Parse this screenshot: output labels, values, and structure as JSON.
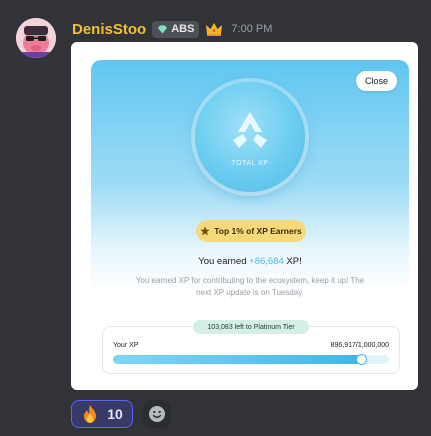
{
  "message": {
    "username": "DenisStoo",
    "role_tag": "ABS",
    "timestamp": "7:00 PM"
  },
  "embed": {
    "close_label": "Close",
    "coin_label": "TOTAL XP",
    "badge_text": "Top 1% of XP Earners",
    "earned_prefix": "You earned ",
    "earned_amount": "+86,684",
    "earned_suffix": " XP!",
    "description": "You earned XP for contributing to the ecosystem, keep it up! The next XP update is on Tuesday.",
    "left_to_tier": "103,083 left to Platinum Tier",
    "your_xp_label": "Your XP",
    "xp_value": "896,917/1,000,000",
    "xp_progress": 0.897
  },
  "reaction": {
    "emoji": "fire",
    "count": "10"
  },
  "colors": {
    "username": "#f0c03a",
    "accent": "#4fb9e6",
    "reaction_border": "#5865f2"
  }
}
